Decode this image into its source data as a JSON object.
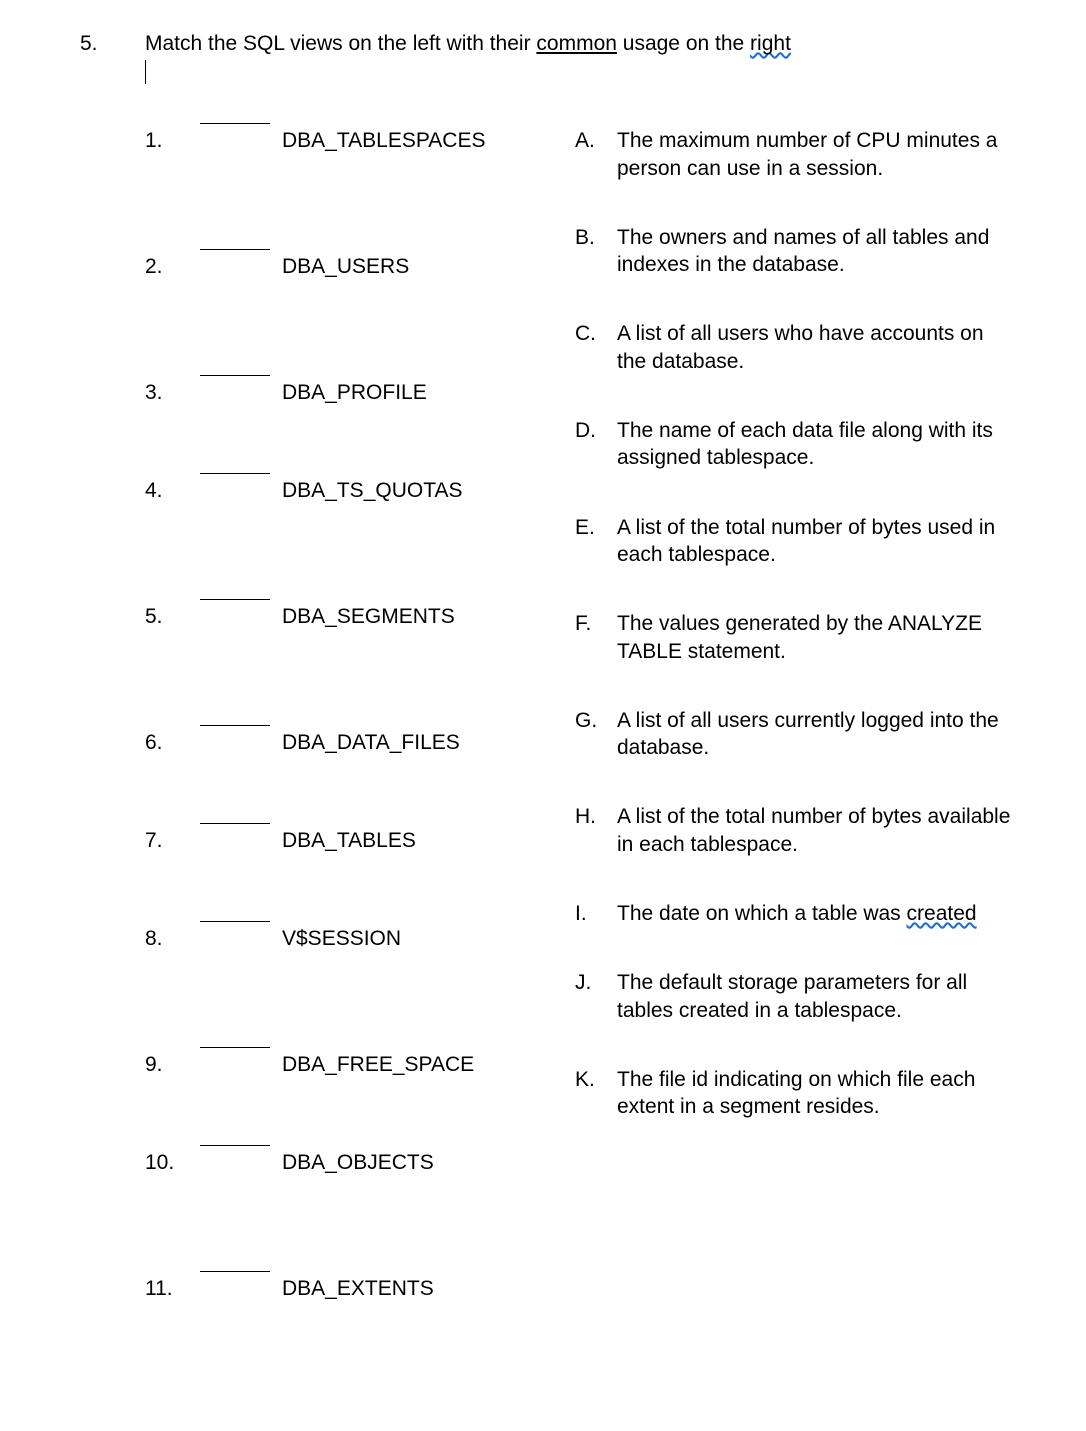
{
  "question": {
    "number": "5.",
    "text_pre": "Match the SQL views on the left with their ",
    "underline1": "common",
    "text_mid": " usage on the ",
    "underline2": "right"
  },
  "left_items": [
    {
      "num": "1.",
      "view": "DBA_TABLESPACES"
    },
    {
      "num": "2.",
      "view": "DBA_USERS"
    },
    {
      "num": "3.",
      "view": "DBA_PROFILE"
    },
    {
      "num": "4.",
      "view": "DBA_TS_QUOTAS"
    },
    {
      "num": "5.",
      "view": "DBA_SEGMENTS"
    },
    {
      "num": "6.",
      "view": "DBA_DATA_FILES"
    },
    {
      "num": "7.",
      "view": "DBA_TABLES"
    },
    {
      "num": "8.",
      "view": "V$SESSION"
    },
    {
      "num": "9.",
      "view": "DBA_FREE_SPACE"
    },
    {
      "num": "10.",
      "view": "DBA_OBJECTS"
    },
    {
      "num": "11.",
      "view": "DBA_EXTENTS"
    }
  ],
  "right_items": [
    {
      "letter": "A.",
      "desc": "The maximum number of CPU minutes a person can use in a session."
    },
    {
      "letter": "B.",
      "desc": "The owners and names of all tables and indexes in the database."
    },
    {
      "letter": "C.",
      "desc": "A list of all users who have accounts on the database."
    },
    {
      "letter": "D.",
      "desc": "The name of each data file along with its assigned tablespace."
    },
    {
      "letter": "E.",
      "desc": "A list of the total number of bytes used in each tablespace."
    },
    {
      "letter": "F.",
      "desc": "The values generated by the ANALYZE TABLE statement."
    },
    {
      "letter": "G.",
      "desc": "A list of all users currently logged into the database."
    },
    {
      "letter": "H.",
      "desc": "A list of the total number of bytes available in each tablespace."
    },
    {
      "letter": "I.",
      "desc_pre": "The date on which a table was ",
      "desc_spell": "created"
    },
    {
      "letter": "J.",
      "desc": "The default storage parameters for all tables created in a tablespace."
    },
    {
      "letter": "K.",
      "desc": "The file id indicating on which file each extent in a segment resides."
    }
  ],
  "left_height_map": [
    "h3",
    "h3",
    "h2",
    "h3",
    "h3",
    "h2",
    "h2",
    "h3",
    "h2",
    "h3",
    "h3"
  ]
}
